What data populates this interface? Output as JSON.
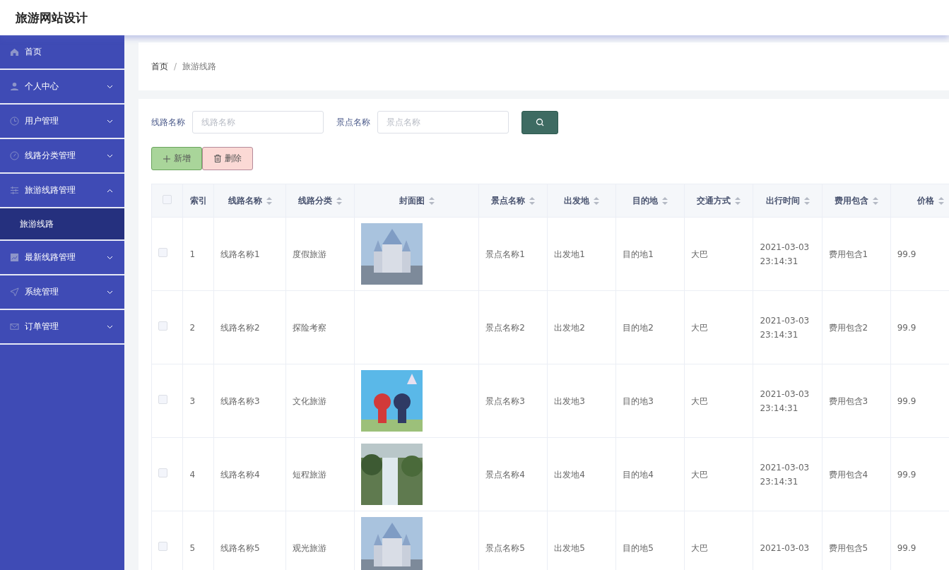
{
  "header": {
    "title": "旅游网站设计"
  },
  "sidebar": {
    "items": [
      {
        "kind": "link",
        "label": "首页"
      },
      {
        "kind": "menu",
        "label": "个人中心",
        "expanded": false
      },
      {
        "kind": "menu",
        "label": "用户管理",
        "expanded": false
      },
      {
        "kind": "menu",
        "label": "线路分类管理",
        "expanded": false
      },
      {
        "kind": "menu",
        "label": "旅游线路管理",
        "expanded": true,
        "children": [
          {
            "label": "旅游线路",
            "selected": true
          }
        ]
      },
      {
        "kind": "menu",
        "label": "最新线路管理",
        "expanded": false
      },
      {
        "kind": "menu",
        "label": "系统管理",
        "expanded": false
      },
      {
        "kind": "menu",
        "label": "订单管理",
        "expanded": false
      }
    ]
  },
  "breadcrumb": {
    "separator": "/",
    "items": [
      "首页",
      "旅游线路"
    ]
  },
  "search": {
    "fields": [
      {
        "label": "线路名称",
        "placeholder": "线路名称"
      },
      {
        "label": "景点名称",
        "placeholder": "景点名称"
      }
    ]
  },
  "actions": [
    {
      "kind": "add",
      "label": "新增"
    },
    {
      "kind": "delete",
      "label": "删除"
    }
  ],
  "table": {
    "select_all": {
      "checked": false
    },
    "columns": [
      {
        "label": "索引",
        "sortable": false
      },
      {
        "label": "线路名称",
        "sortable": true
      },
      {
        "label": "线路分类",
        "sortable": true
      },
      {
        "label": "封面图",
        "sortable": true
      },
      {
        "label": "景点名称",
        "sortable": true
      },
      {
        "label": "出发地",
        "sortable": true
      },
      {
        "label": "目的地",
        "sortable": true
      },
      {
        "label": "交通方式",
        "sortable": true
      },
      {
        "label": "出行时间",
        "sortable": true
      },
      {
        "label": "费用包含",
        "sortable": true
      },
      {
        "label": "价格",
        "sortable": true
      }
    ],
    "rows": [
      {
        "checked": false,
        "index": "1",
        "name": "线路名称1",
        "category": "度假旅游",
        "cover": {
          "kind": "picture"
        },
        "spot": "景点名称1",
        "from": "出发地1",
        "to": "目的地1",
        "transport": "大巴",
        "time": [
          "2021-03-03",
          "23:14:31"
        ],
        "includes": "费用包含1",
        "price": "99.9"
      },
      {
        "checked": false,
        "index": "2",
        "name": "线路名称2",
        "category": "探险考察",
        "spot": "景点名称2",
        "from": "出发地2",
        "to": "目的地2",
        "transport": "大巴",
        "time": [
          "2021-03-03",
          "23:14:31"
        ],
        "includes": "费用包含2",
        "price": "99.9"
      },
      {
        "checked": false,
        "index": "3",
        "name": "线路名称3",
        "category": "文化旅游",
        "cover": {
          "kind": "picture"
        },
        "spot": "景点名称3",
        "from": "出发地3",
        "to": "目的地3",
        "transport": "大巴",
        "time": [
          "2021-03-03",
          "23:14:31"
        ],
        "includes": "费用包含3",
        "price": "99.9"
      },
      {
        "checked": false,
        "index": "4",
        "name": "线路名称4",
        "category": "短程旅游",
        "cover": {
          "kind": "picture"
        },
        "spot": "景点名称4",
        "from": "出发地4",
        "to": "目的地4",
        "transport": "大巴",
        "time": [
          "2021-03-03",
          "23:14:31"
        ],
        "includes": "费用包含4",
        "price": "99.9"
      },
      {
        "checked": false,
        "index": "5",
        "name": "线路名称5",
        "category": "观光旅游",
        "cover": {
          "kind": "picture"
        },
        "spot": "景点名称5",
        "from": "出发地5",
        "to": "目的地5",
        "transport": "大巴",
        "time": [
          "2021-03-03"
        ],
        "includes": "费用包含5",
        "price": "99.9"
      }
    ]
  }
}
